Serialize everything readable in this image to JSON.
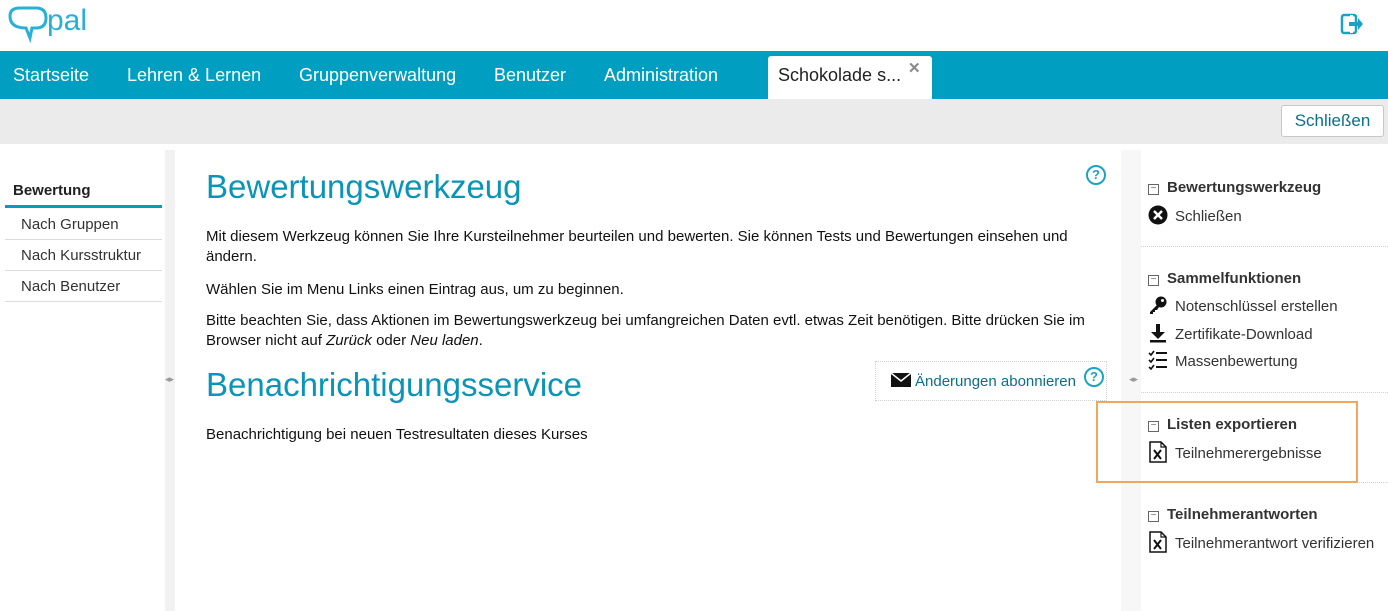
{
  "header": {
    "logo_text": "Opal",
    "logout_icon": "logout-icon"
  },
  "nav": {
    "items": [
      "Startseite",
      "Lehren & Lernen",
      "Gruppenverwaltung",
      "Benutzer",
      "Administration"
    ],
    "active_tab": "Schokolade s...",
    "active_tab_close": "✕"
  },
  "toolbar": {
    "close_label": "Schließen"
  },
  "left_menu": {
    "heading": "Bewertung",
    "items": [
      "Nach Gruppen",
      "Nach Kursstruktur",
      "Nach Benutzer"
    ]
  },
  "main": {
    "title": "Bewertungswerkzeug",
    "para1": "Mit diesem Werkzeug können Sie Ihre Kursteilnehmer beurteilen und bewerten. Sie können Tests und Bewertungen einsehen und ändern.",
    "para2": "Wählen Sie im Menu Links einen Eintrag aus, um zu beginnen.",
    "para3_a": "Bitte beachten Sie, dass Aktionen im Bewertungswerkzeug bei umfangreichen Daten evtl. etwas Zeit benötigen. Bitte drücken Sie im Browser nicht auf ",
    "para3_b": "Zurück",
    "para3_c": " oder ",
    "para3_d": "Neu laden",
    "para3_e": ".",
    "notify_title": "Benachrichtigungsservice",
    "subscribe_label": "Änderungen abonnieren",
    "notify_text": "Benachrichtigung bei neuen Testresultaten dieses Kurses",
    "help_symbol": "?"
  },
  "right_panel": {
    "sections": [
      {
        "heading": "Bewertungswerkzeug",
        "items": [
          {
            "label": "Schließen",
            "icon": "close-circle-icon"
          }
        ]
      },
      {
        "heading": "Sammelfunktionen",
        "items": [
          {
            "label": "Notenschlüssel erstellen",
            "icon": "key-icon"
          },
          {
            "label": "Zertifikate-Download",
            "icon": "download-icon"
          },
          {
            "label": "Massenbewertung",
            "icon": "checklist-icon"
          }
        ]
      },
      {
        "heading": "Listen exportieren",
        "items": [
          {
            "label": "Teilnehmerergebnisse",
            "icon": "excel-file-icon"
          }
        ]
      },
      {
        "heading": "Teilnehmerantworten",
        "items": [
          {
            "label": "Teilnehmerantwort verifizieren",
            "icon": "excel-file-icon"
          }
        ]
      }
    ]
  },
  "colors": {
    "accent": "#009ec0",
    "title": "#0a94b8",
    "highlight": "#f2a65a"
  }
}
